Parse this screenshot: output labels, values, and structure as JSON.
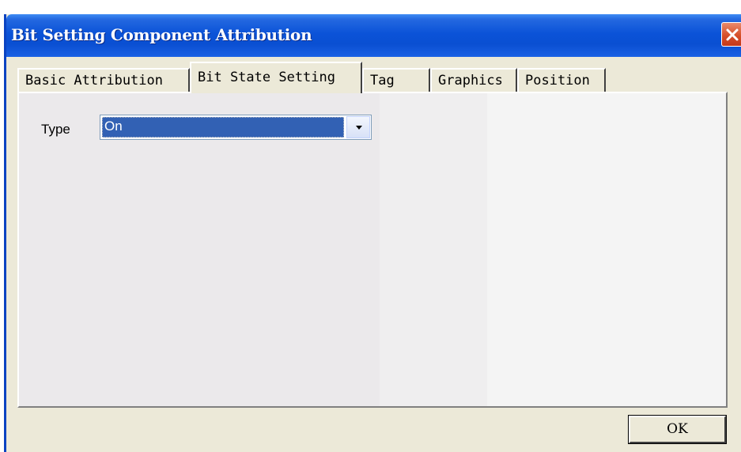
{
  "window": {
    "title": "Bit Setting Component Attribution",
    "titlebar_color": "#0a4fd2",
    "close_icon": "close-icon"
  },
  "tabs": [
    {
      "label": "Basic Attribution",
      "active": false
    },
    {
      "label": "Bit State Setting",
      "active": true
    },
    {
      "label": "Tag",
      "active": false
    },
    {
      "label": "Graphics",
      "active": false
    },
    {
      "label": "Position",
      "active": false
    }
  ],
  "panel": {
    "type_label": "Type",
    "type_value": "On",
    "type_selected_color": "#3261b4"
  },
  "footer": {
    "ok_label": "OK"
  }
}
